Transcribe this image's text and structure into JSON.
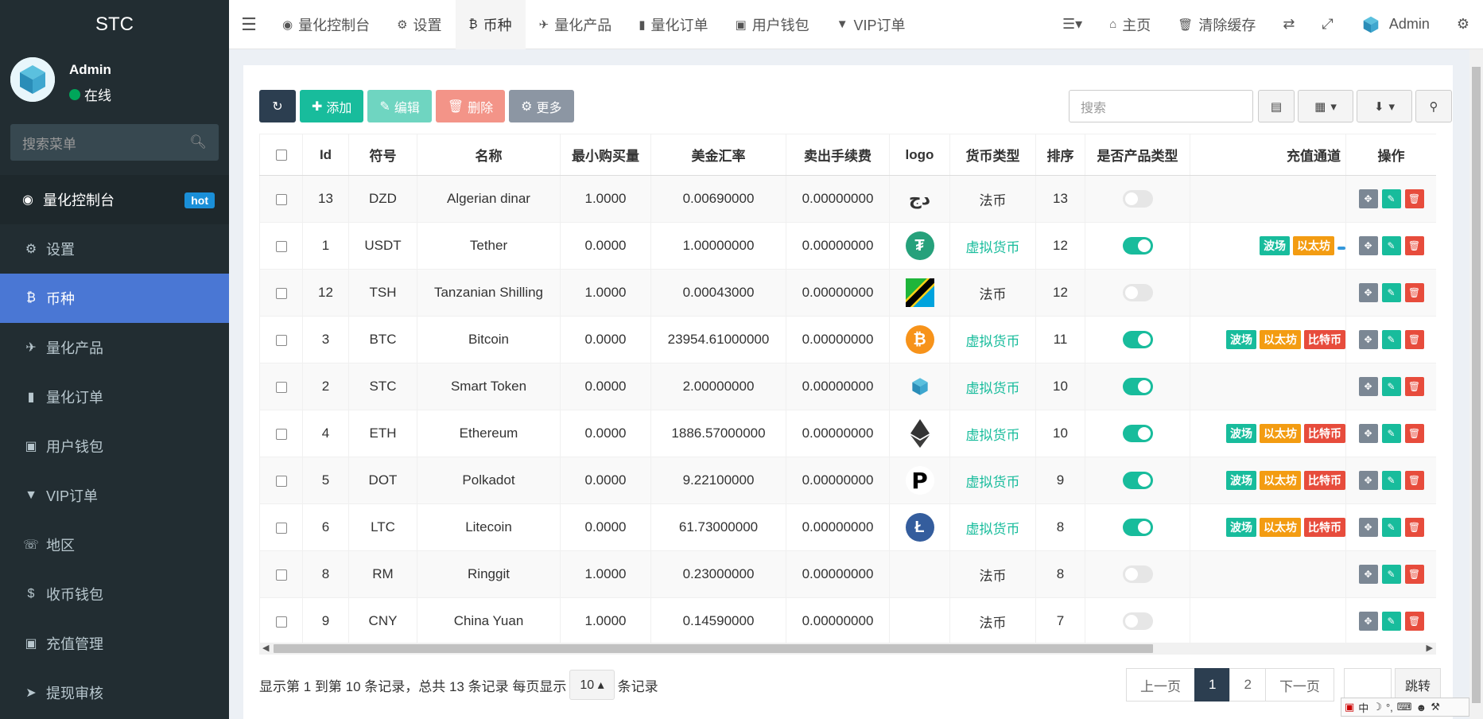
{
  "brand": "STC",
  "user": {
    "name": "Admin",
    "status": "在线"
  },
  "sidebar": {
    "search_placeholder": "搜索菜单",
    "items": [
      {
        "label": "量化控制台",
        "icon": "dashboard-icon",
        "badge": "hot",
        "state": "top"
      },
      {
        "label": "设置",
        "icon": "gear-icon"
      },
      {
        "label": "币种",
        "icon": "bitcoin-icon",
        "state": "active"
      },
      {
        "label": "量化产品",
        "icon": "plane-icon"
      },
      {
        "label": "量化订单",
        "icon": "book-icon"
      },
      {
        "label": "用户钱包",
        "icon": "money-icon"
      },
      {
        "label": "VIP订单",
        "icon": "vip-icon"
      },
      {
        "label": "地区",
        "icon": "phone-book-icon"
      },
      {
        "label": "收币钱包",
        "icon": "dollar-icon"
      },
      {
        "label": "充值管理",
        "icon": "money-icon"
      },
      {
        "label": "提现审核",
        "icon": "arrow-circle-icon"
      }
    ]
  },
  "topnav": {
    "tabs": [
      {
        "label": "量化控制台",
        "icon": "dashboard-icon"
      },
      {
        "label": "设置",
        "icon": "gear-icon"
      },
      {
        "label": "币种",
        "icon": "bitcoin-icon",
        "active": true
      },
      {
        "label": "量化产品",
        "icon": "plane-icon"
      },
      {
        "label": "量化订单",
        "icon": "book-icon"
      },
      {
        "label": "用户钱包",
        "icon": "money-icon"
      },
      {
        "label": "VIP订单",
        "icon": "vip-icon"
      }
    ],
    "home": "主页",
    "clear_cache": "清除缓存",
    "admin": "Admin"
  },
  "toolbar": {
    "add": "添加",
    "edit": "编辑",
    "delete": "删除",
    "more": "更多",
    "search_placeholder": "搜索"
  },
  "table": {
    "columns": [
      "Id",
      "符号",
      "名称",
      "最小购买量",
      "美金汇率",
      "卖出手续费",
      "logo",
      "货币类型",
      "排序",
      "是否产品类型",
      "充值通道",
      "操作"
    ],
    "rows": [
      {
        "id": "13",
        "symbol": "DZD",
        "name": "Algerian dinar",
        "min": "1.0000",
        "rate": "0.00690000",
        "fee": "0.00000000",
        "logo": "dzd",
        "type": "法币",
        "virtual": false,
        "sort": "13",
        "product": false,
        "channels": []
      },
      {
        "id": "1",
        "symbol": "USDT",
        "name": "Tether",
        "min": "0.0000",
        "rate": "1.00000000",
        "fee": "0.00000000",
        "logo": "usdt",
        "type": "虚拟货币",
        "virtual": true,
        "sort": "12",
        "product": true,
        "channels": [
          "波场",
          "以太坊",
          ""
        ]
      },
      {
        "id": "12",
        "symbol": "TSH",
        "name": "Tanzanian Shilling",
        "min": "1.0000",
        "rate": "0.00043000",
        "fee": "0.00000000",
        "logo": "tsh",
        "type": "法币",
        "virtual": false,
        "sort": "12",
        "product": false,
        "channels": []
      },
      {
        "id": "3",
        "symbol": "BTC",
        "name": "Bitcoin",
        "min": "0.0000",
        "rate": "23954.61000000",
        "fee": "0.00000000",
        "logo": "btc",
        "type": "虚拟货币",
        "virtual": true,
        "sort": "11",
        "product": true,
        "channels": [
          "波场",
          "以太坊",
          "比特币"
        ]
      },
      {
        "id": "2",
        "symbol": "STC",
        "name": "Smart Token",
        "min": "0.0000",
        "rate": "2.00000000",
        "fee": "0.00000000",
        "logo": "stc",
        "type": "虚拟货币",
        "virtual": true,
        "sort": "10",
        "product": true,
        "channels": []
      },
      {
        "id": "4",
        "symbol": "ETH",
        "name": "Ethereum",
        "min": "0.0000",
        "rate": "1886.57000000",
        "fee": "0.00000000",
        "logo": "eth",
        "type": "虚拟货币",
        "virtual": true,
        "sort": "10",
        "product": true,
        "channels": [
          "波场",
          "以太坊",
          "比特币"
        ]
      },
      {
        "id": "5",
        "symbol": "DOT",
        "name": "Polkadot",
        "min": "0.0000",
        "rate": "9.22100000",
        "fee": "0.00000000",
        "logo": "dot",
        "type": "虚拟货币",
        "virtual": true,
        "sort": "9",
        "product": true,
        "channels": [
          "波场",
          "以太坊",
          "比特币"
        ]
      },
      {
        "id": "6",
        "symbol": "LTC",
        "name": "Litecoin",
        "min": "0.0000",
        "rate": "61.73000000",
        "fee": "0.00000000",
        "logo": "ltc",
        "type": "虚拟货币",
        "virtual": true,
        "sort": "8",
        "product": true,
        "channels": [
          "波场",
          "以太坊",
          "比特币"
        ]
      },
      {
        "id": "8",
        "symbol": "RM",
        "name": "Ringgit",
        "min": "1.0000",
        "rate": "0.23000000",
        "fee": "0.00000000",
        "logo": "",
        "type": "法币",
        "virtual": false,
        "sort": "8",
        "product": false,
        "channels": []
      },
      {
        "id": "9",
        "symbol": "CNY",
        "name": "China Yuan",
        "min": "1.0000",
        "rate": "0.14590000",
        "fee": "0.00000000",
        "logo": "",
        "type": "法币",
        "virtual": false,
        "sort": "7",
        "product": false,
        "channels": []
      }
    ]
  },
  "pagination": {
    "info_prefix": "显示第 1 到第 10 条记录，总共 13 条记录 每页显示",
    "page_size": "10",
    "info_suffix": "条记录",
    "prev": "上一页",
    "pages": [
      "1",
      "2"
    ],
    "current": "1",
    "next": "下一页",
    "jump": "跳转"
  },
  "ime": {
    "mode": "中"
  },
  "colors": {
    "sidebar": "#222d32",
    "active": "#4a77d4",
    "success": "#18bc9c",
    "danger": "#e74c3c",
    "warning": "#f39c12",
    "dark": "#2c3e50"
  }
}
